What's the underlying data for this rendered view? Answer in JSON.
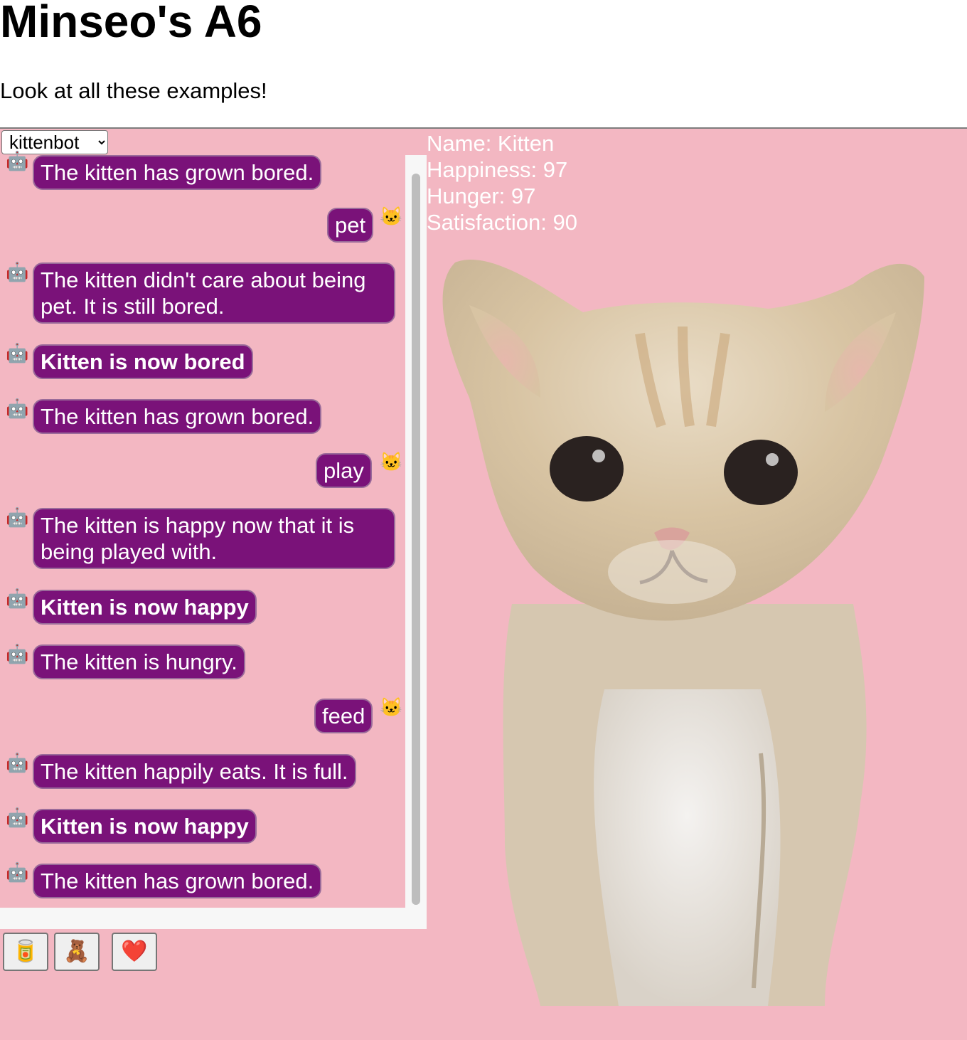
{
  "page": {
    "title": "Minseo's A6",
    "subtitle": "Look at all these examples!"
  },
  "selector": {
    "selected": "kittenbot",
    "options": [
      "kittenbot"
    ]
  },
  "chat": {
    "messages": [
      {
        "from": "bot",
        "text": "The kitten has grown bored.",
        "bold": false
      },
      {
        "from": "user",
        "text": "pet"
      },
      {
        "from": "bot",
        "text": "The kitten didn't care about being pet. It is still bored.",
        "bold": false
      },
      {
        "from": "bot",
        "text": "Kitten is now bored",
        "bold": true
      },
      {
        "from": "bot",
        "text": "The kitten has grown bored.",
        "bold": false
      },
      {
        "from": "user",
        "text": "play"
      },
      {
        "from": "bot",
        "text": "The kitten is happy now that it is being played with.",
        "bold": false
      },
      {
        "from": "bot",
        "text": "Kitten is now happy",
        "bold": true
      },
      {
        "from": "bot",
        "text": "The kitten is hungry.",
        "bold": false
      },
      {
        "from": "user",
        "text": "feed"
      },
      {
        "from": "bot",
        "text": "The kitten happily eats. It is full.",
        "bold": false
      },
      {
        "from": "bot",
        "text": "Kitten is now happy",
        "bold": true
      },
      {
        "from": "bot",
        "text": "The kitten has grown bored.",
        "bold": false
      }
    ],
    "bot_avatar": "🤖",
    "user_avatar": "🐱"
  },
  "stats": {
    "name": "Name: Kitten",
    "happiness": "Happiness: 97",
    "hunger": "Hunger: 97",
    "satisfaction": "Satisfaction: 90"
  },
  "actions": [
    {
      "icon": "food-can-icon",
      "glyph": "🥫"
    },
    {
      "icon": "teddy-bear-icon",
      "glyph": "🧸"
    },
    {
      "icon": "heart-icon",
      "glyph": "❤️"
    }
  ],
  "colors": {
    "background": "#f3b7c2",
    "bubble": "#7a1279",
    "bubble_text": "#ffffff",
    "stats_text": "#ffffff"
  }
}
